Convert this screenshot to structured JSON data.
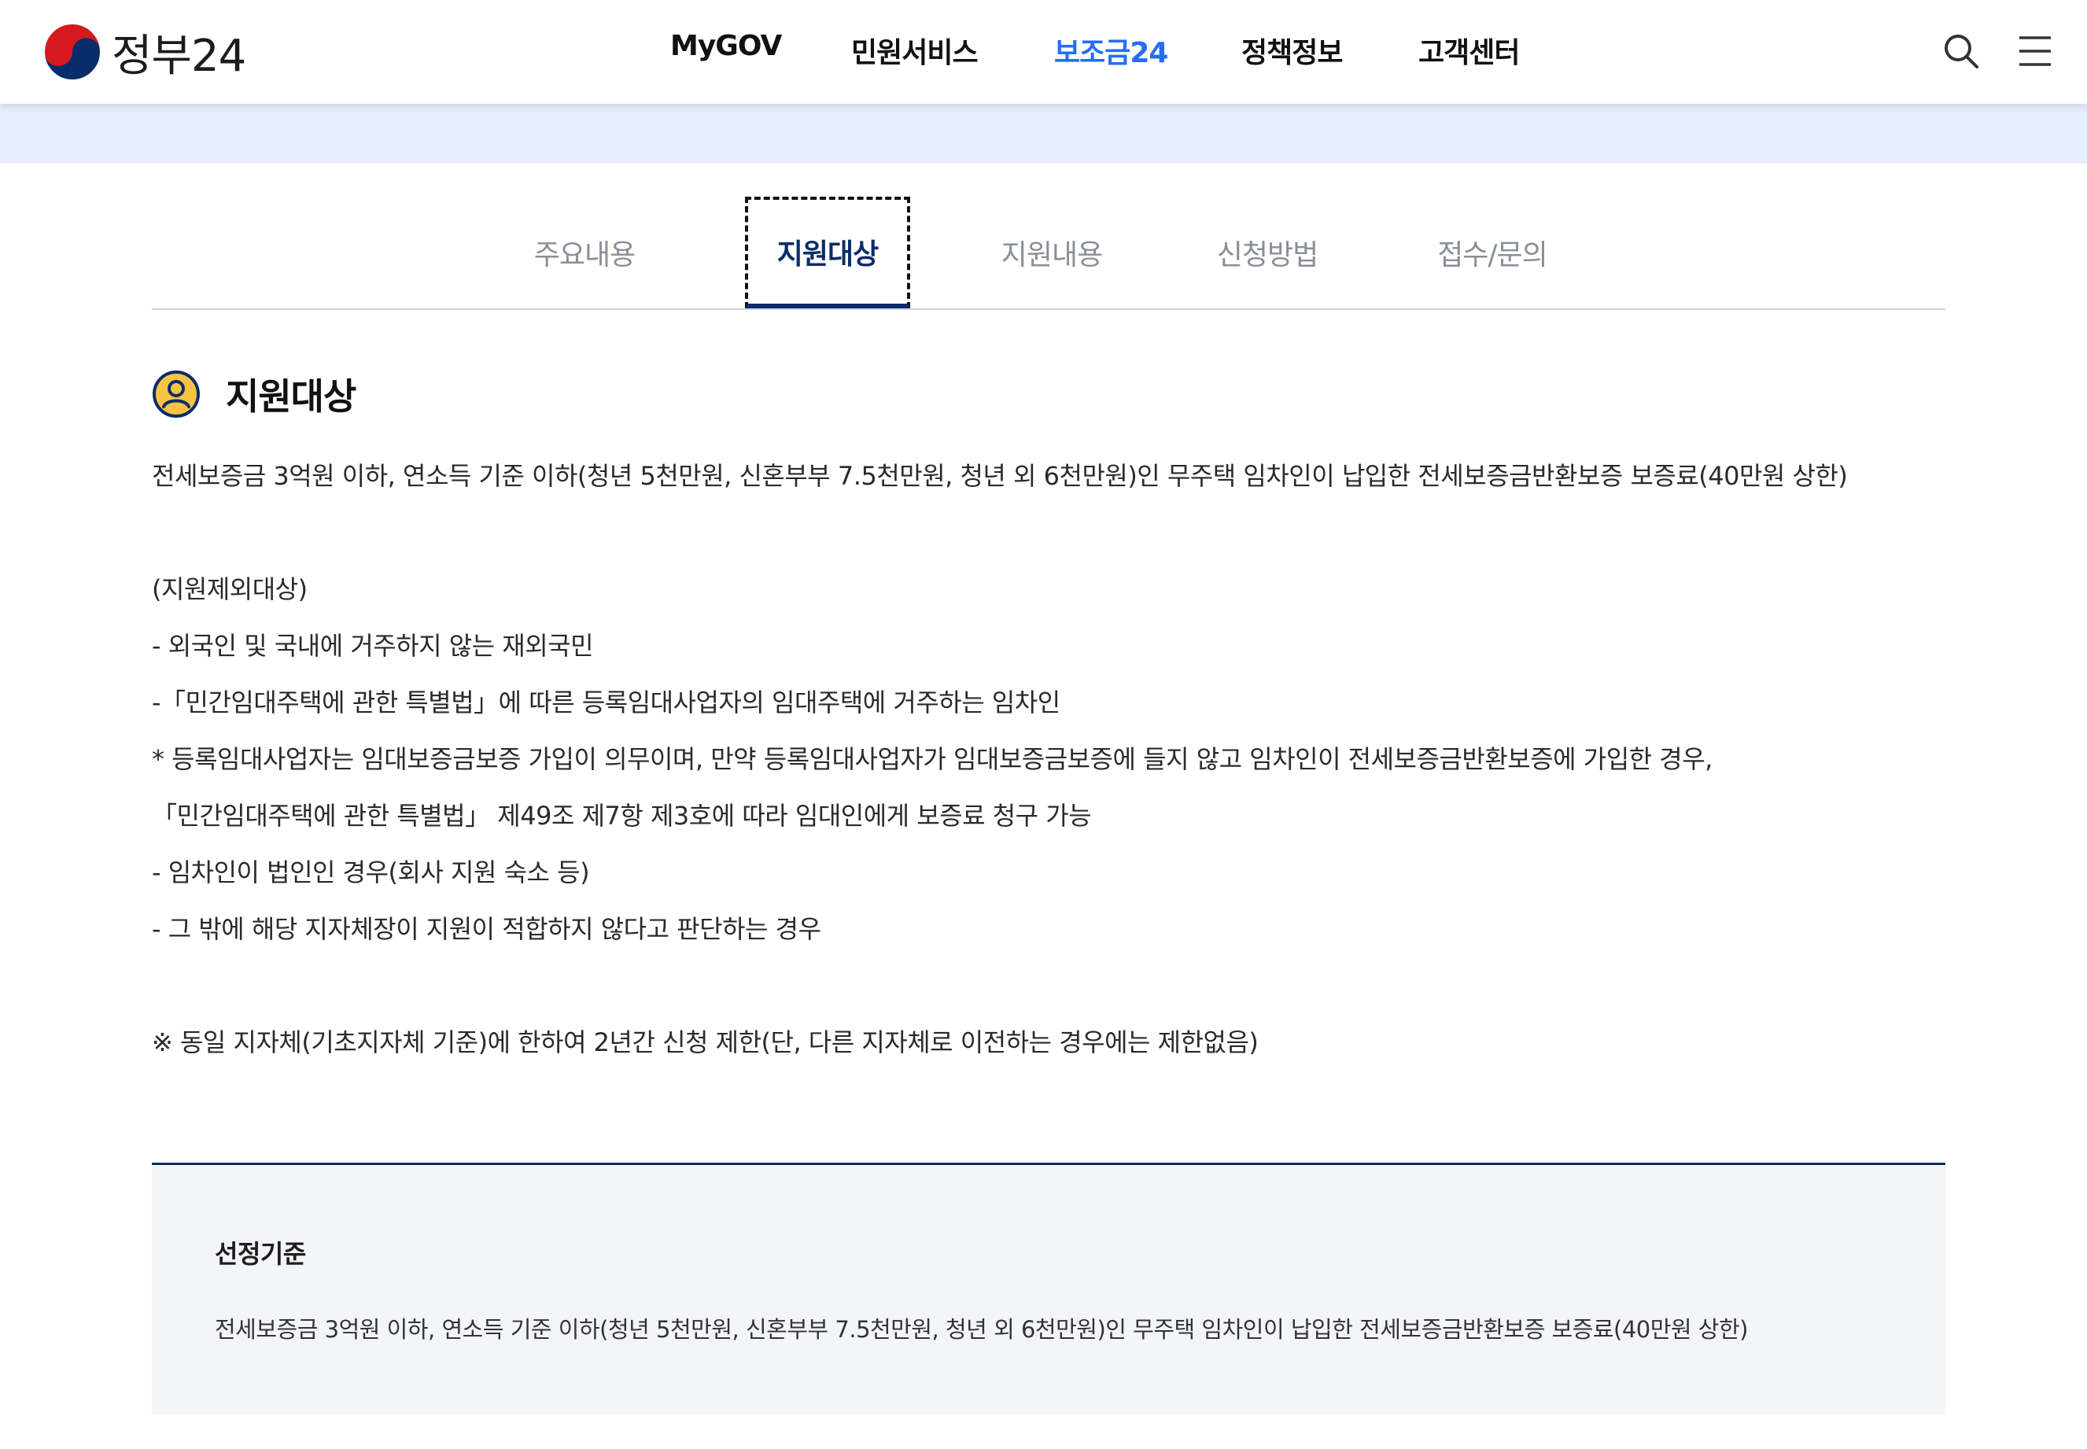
{
  "header": {
    "logo_text": "정부24",
    "nav": [
      "MyGOV",
      "민원서비스",
      "보조금24",
      "정책정보",
      "고객센터"
    ],
    "active_nav": "보조금24",
    "accent_color": "#256ef4"
  },
  "tabs": {
    "items": [
      "주요내용",
      "지원대상",
      "지원내용",
      "신청방법",
      "접수/문의"
    ],
    "active": "지원대상"
  },
  "section": {
    "title": "지원대상",
    "lines": [
      "전세보증금 3억원 이하, 연소득 기준 이하(청년 5천만원, 신혼부부 7.5천만원, 청년 외 6천만원)인 무주택 임차인이 납입한 전세보증금반환보증 보증료(40만원 상한)",
      "(지원제외대상)",
      "- 외국인 및 국내에 거주하지 않는 재외국민",
      "-「민간임대주택에 관한 특별법」에 따른 등록임대사업자의 임대주택에 거주하는 임차인",
      "* 등록임대사업자는 임대보증금보증 가입이 의무이며, 만약 등록임대사업자가 임대보증금보증에 들지 않고 임차인이 전세보증금반환보증에 가입한 경우,",
      "「민간임대주택에 관한 특별법」 제49조 제7항 제3호에 따라 임대인에게 보증료 청구 가능",
      "- 임차인이 법인인 경우(회사 지원 숙소 등)",
      "- 그 밖에 해당 지자체장이 지원이 적합하지 않다고 판단하는 경우",
      "※ 동일 지자체(기초지자체 기준)에 한하여 2년간 신청 제한(단, 다른 지자체로 이전하는 경우에는 제한없음)"
    ]
  },
  "criteria": {
    "title": "선정기준",
    "text": "전세보증금 3억원 이하, 연소득 기준 이하(청년 5천만원, 신혼부부 7.5천만원, 청년 외 6천만원)인 무주택 임차인이 납입한 전세보증금반환보증 보증료(40만원 상한)"
  },
  "icons": {
    "search": "search-icon",
    "menu": "hamburger-menu-icon",
    "section": "user-circle-icon"
  }
}
